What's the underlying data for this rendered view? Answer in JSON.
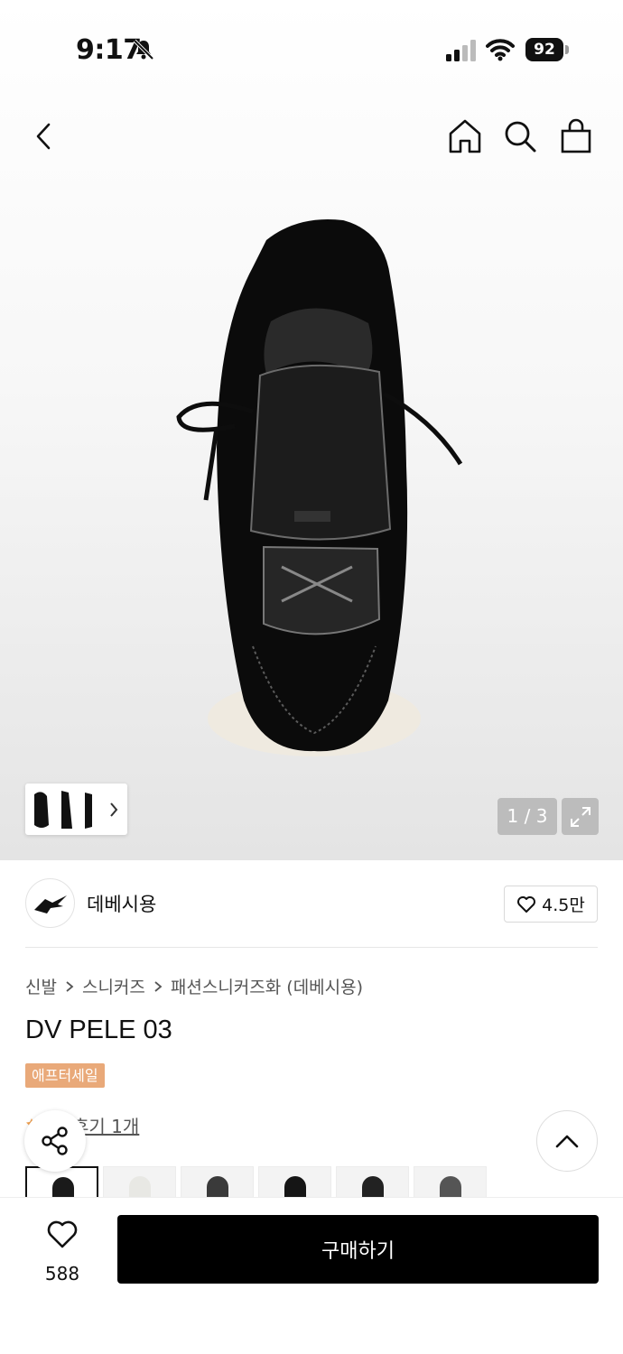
{
  "status_bar": {
    "time": "9:17",
    "battery": "92"
  },
  "icons": {
    "back": "back-arrow-icon",
    "home": "home-icon",
    "search": "search-icon",
    "cart": "shopping-bag-icon",
    "share": "share-icon",
    "heart": "heart-icon",
    "top": "chevron-up-icon",
    "expand": "expand-icon"
  },
  "gallery": {
    "pager": "1 / 3"
  },
  "brand": {
    "name": "데베시용",
    "likes": "4.5만"
  },
  "breadcrumb": [
    "신발",
    "스니커즈",
    "패션스니커즈화 (데베시용)"
  ],
  "product": {
    "title": "DV PELE 03",
    "badge": "애프터세일",
    "reviews": "후기 1개"
  },
  "variants": [
    {
      "color": "#1a1a1a",
      "selected": true
    },
    {
      "color": "#e8e8e4",
      "selected": false
    },
    {
      "color": "#3a3a3a",
      "selected": false
    },
    {
      "color": "#151515",
      "selected": false
    },
    {
      "color": "#222222",
      "selected": false
    },
    {
      "color": "#555555",
      "selected": false
    }
  ],
  "bottom_bar": {
    "wishlist_count": "588",
    "buy_label": "구매하기"
  },
  "colors": {
    "badge": "#e9a979",
    "buy_button": "#000000"
  }
}
